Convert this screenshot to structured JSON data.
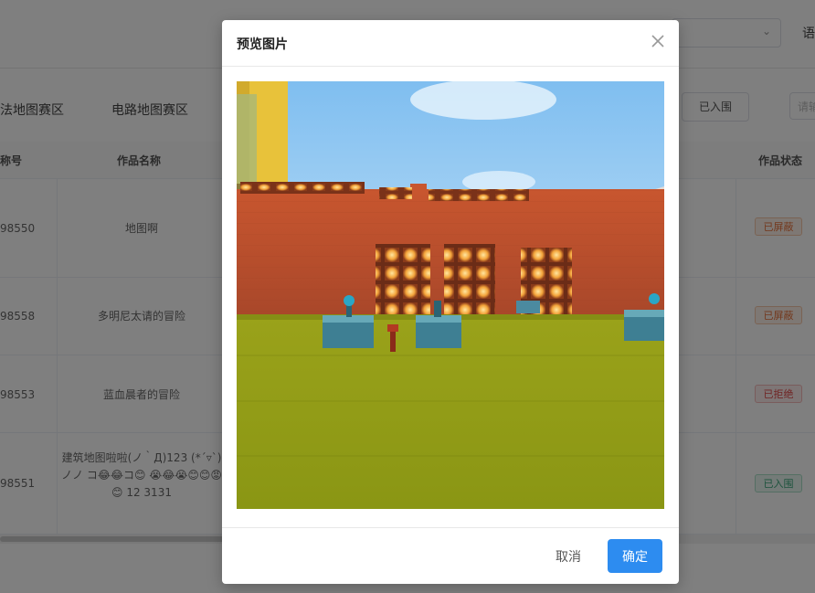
{
  "topbar": {
    "language_label": "语"
  },
  "tabs": [
    "法地图赛区",
    "电路地图赛区"
  ],
  "filter": {
    "button_label": "已入围",
    "input_placeholder": "请输"
  },
  "table": {
    "columns": {
      "id": "称号",
      "name": "作品名称",
      "status": "作品状态"
    },
    "rows": [
      {
        "id": "98550",
        "name": "地图啊",
        "status": "已屏蔽",
        "status_type": "warn"
      },
      {
        "id": "98558",
        "name": "多明尼太请的冒险",
        "status": "已屏蔽",
        "status_type": "warn"
      },
      {
        "id": "98553",
        "name": "蓝血晨者的冒险",
        "status": "已拒绝",
        "status_type": "danger"
      },
      {
        "id": "98551",
        "name": "建筑地图啦啦(ノ｀Д)123 (*´▿`)ノノ コ😂😂コ😊 😭😂😭😊😊😡😊 12 3131",
        "status": "已入围",
        "status_type": "success"
      }
    ]
  },
  "dialog": {
    "title": "预览图片",
    "cancel_label": "取消",
    "ok_label": "确定"
  },
  "colors": {
    "primary": "#2d8cf0",
    "mask": "rgba(0,0,0,0.5)"
  }
}
